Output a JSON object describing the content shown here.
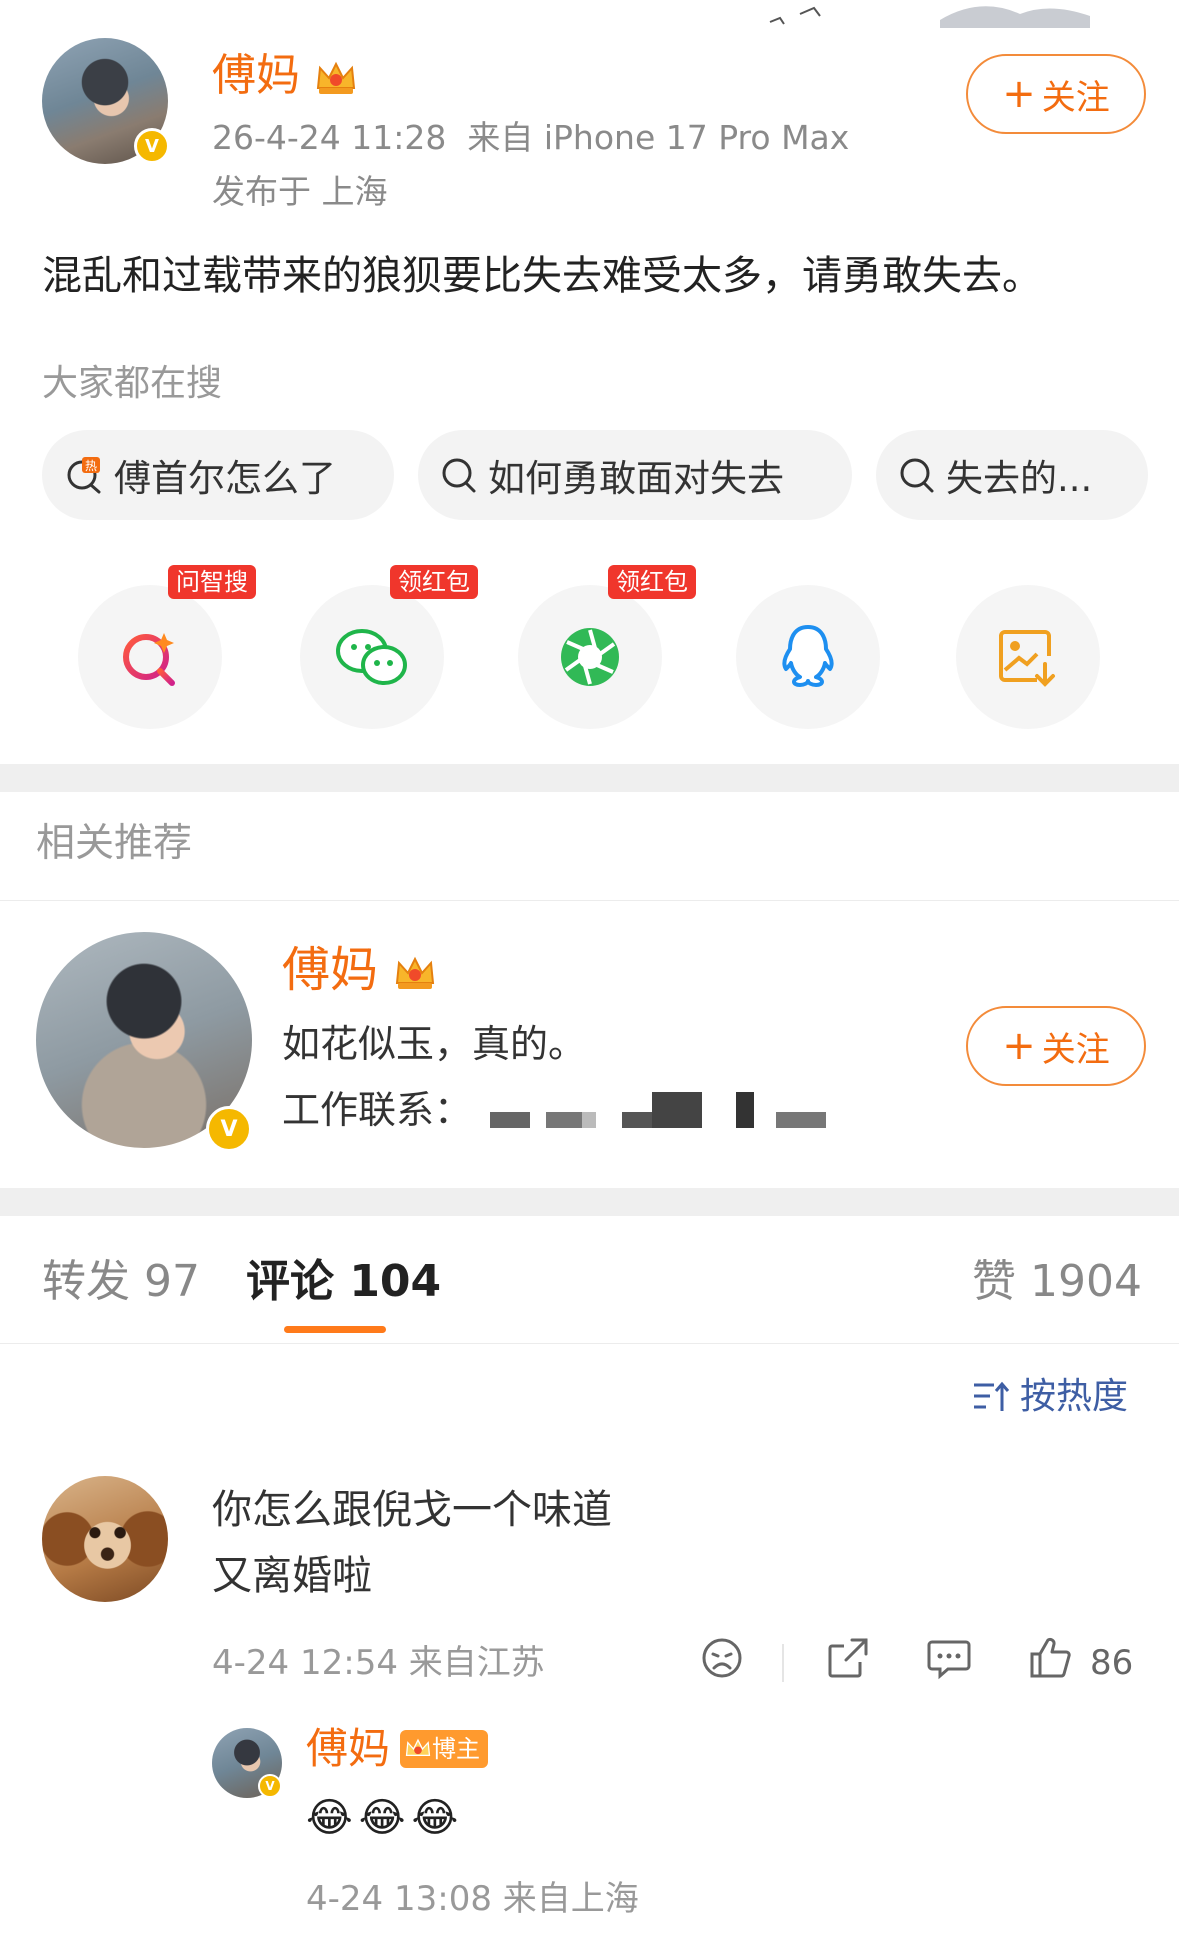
{
  "post": {
    "author_name": "傅妈",
    "timestamp": "26-4-24 11:28",
    "source": "来自 iPhone 17 Pro Max",
    "location": "发布于 上海",
    "follow_label": "关注",
    "text": "混乱和过载带来的狼狈要比失去难受太多，请勇敢失去。"
  },
  "hot_search": {
    "title": "大家都在搜",
    "items": [
      {
        "label": "傅首尔怎么了",
        "icon": "hot-search-icon"
      },
      {
        "label": "如何勇敢面对失去",
        "icon": "search-icon"
      },
      {
        "label": "失去的...",
        "icon": "search-icon"
      }
    ]
  },
  "share": [
    {
      "name": "问智搜",
      "icon": "ai-search-icon",
      "tag": "问智搜"
    },
    {
      "name": "微信",
      "icon": "wechat-icon",
      "tag": "领红包"
    },
    {
      "name": "朋友圈",
      "icon": "moments-icon",
      "tag": "领红包"
    },
    {
      "name": "QQ",
      "icon": "qq-icon",
      "tag": ""
    },
    {
      "name": "保存图片",
      "icon": "save-image-icon",
      "tag": ""
    }
  ],
  "related": {
    "title": "相关推荐",
    "name": "傅妈",
    "bio": "如花似玉，真的。",
    "work_label": "工作联系：",
    "follow_label": "关注"
  },
  "tabs": {
    "repost": "转发 97",
    "comment": "评论 104",
    "like": "赞 1904"
  },
  "sort_label": "按热度",
  "comment": {
    "line1": "你怎么跟倪戈一个味道",
    "line2": "又离婚啦",
    "meta": "4-24 12:54  来自江苏",
    "likes": "86"
  },
  "reply": {
    "name": "傅妈",
    "badge": "博主",
    "emoji": "😂😂😂",
    "meta": "4-24 13:08  来自上海"
  },
  "colors": {
    "accent": "#f36c10",
    "link": "#3e5ea4",
    "tag_red": "#f0362c"
  }
}
